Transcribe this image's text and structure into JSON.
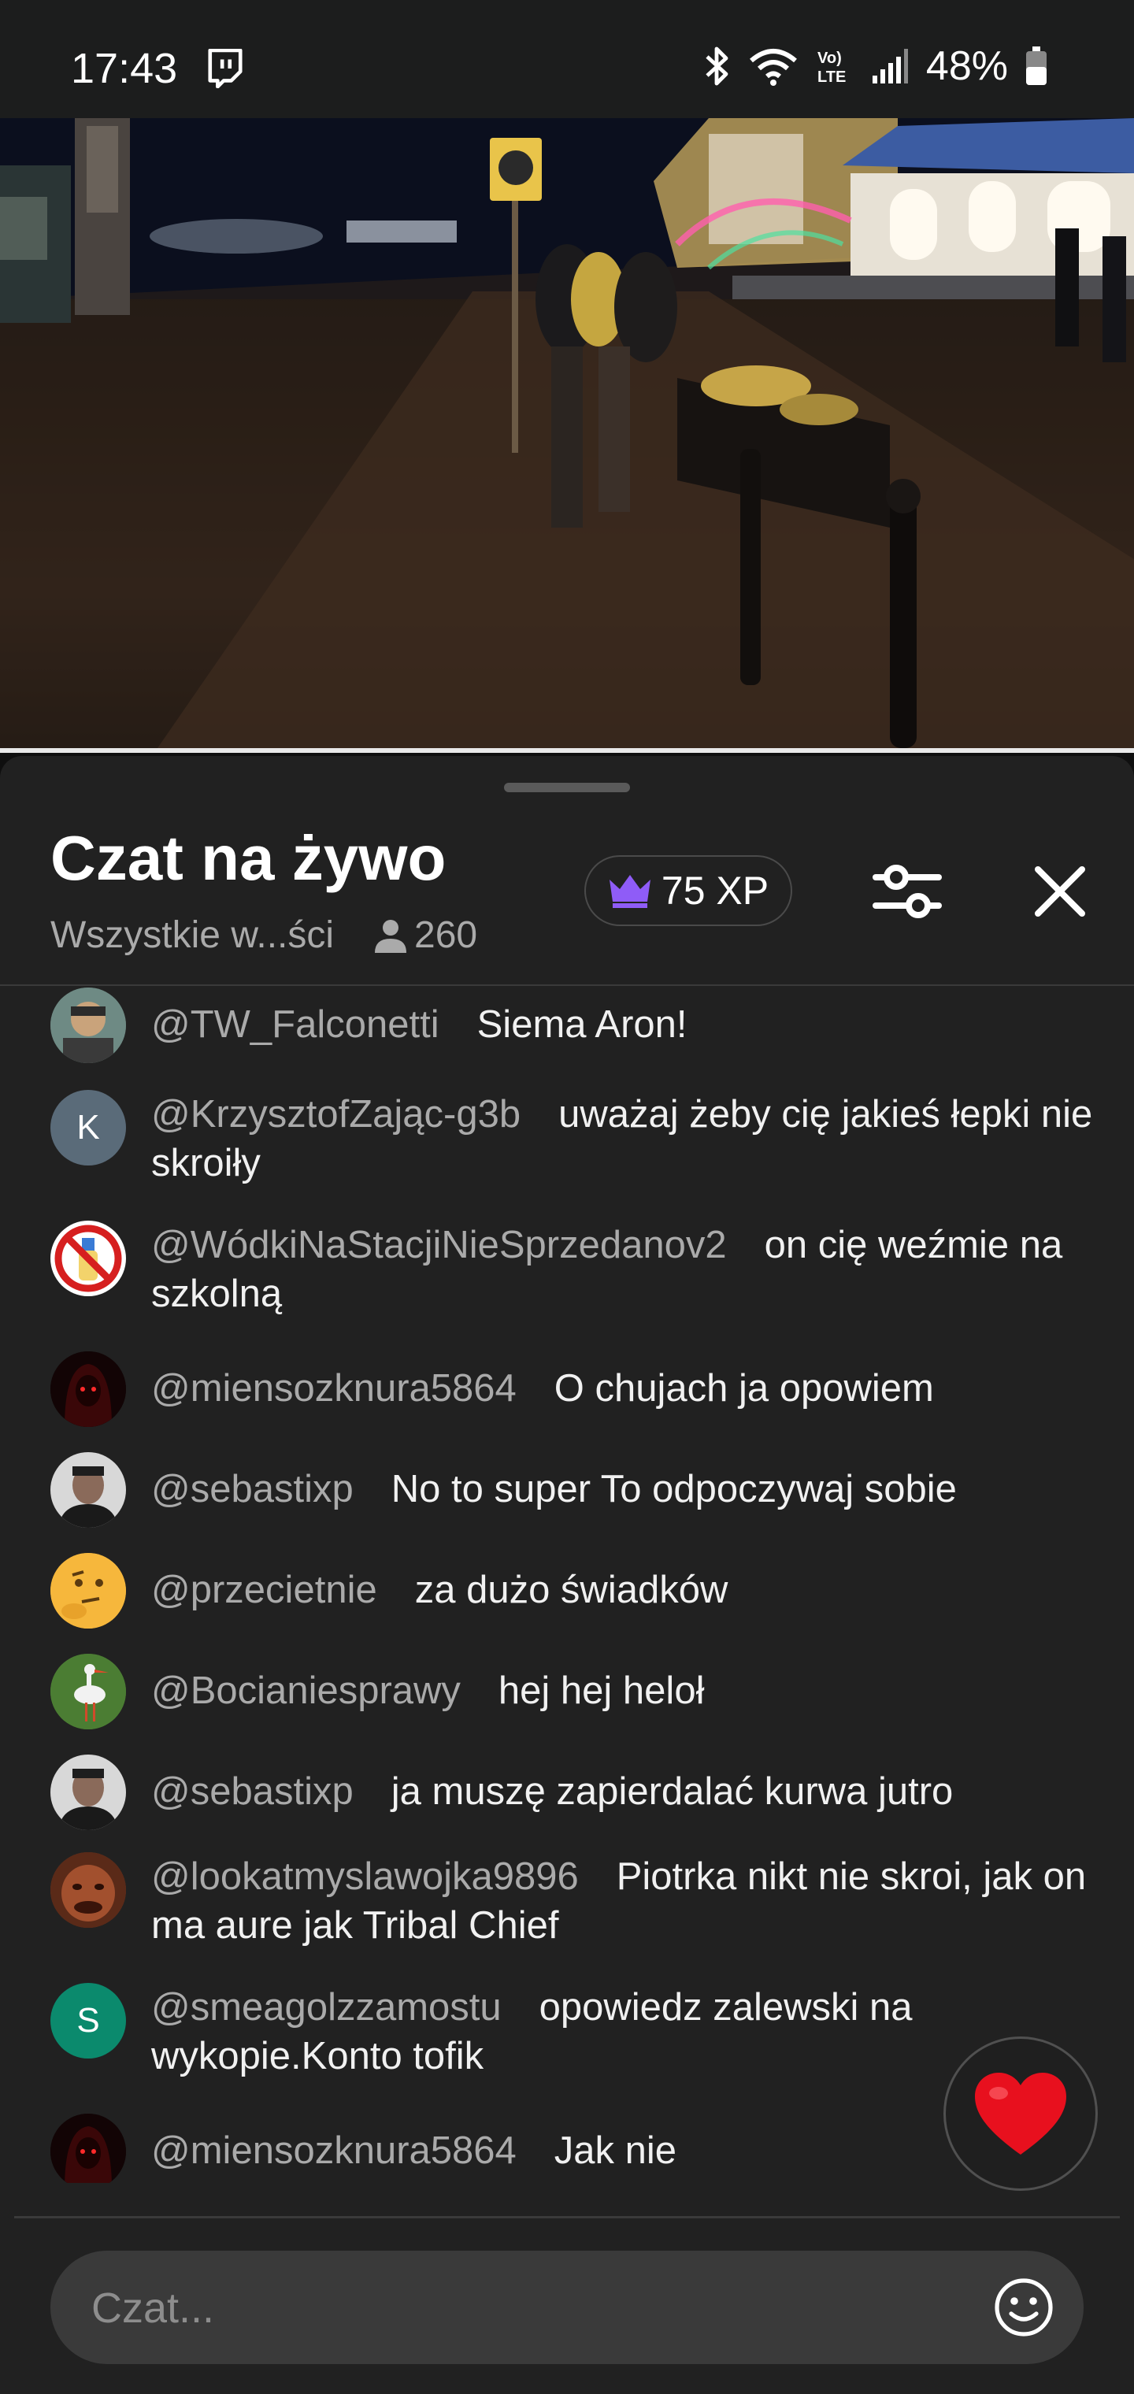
{
  "status_bar": {
    "time": "17:43",
    "battery": "48%",
    "icons": [
      "twitch-icon",
      "bluetooth-icon",
      "wifi-icon",
      "volte-icon",
      "signal-icon",
      "battery-icon"
    ]
  },
  "video": {
    "progress_fraction": 1.0
  },
  "chat": {
    "title": "Czat na żywo",
    "mode_label": "Wszystkie w...ści",
    "viewers": "260",
    "xp": "75 XP",
    "accent_color": "#8f5cf7"
  },
  "messages": [
    {
      "author": "@TW_Falconetti",
      "text": "Siema Aron!",
      "avatar": "photo"
    },
    {
      "author": "@KrzysztofZając-g3b",
      "text": "uważaj żeby cię jakieś łepki nie skroiły",
      "avatar_letter": "K",
      "avatar_color": "#5a6b79"
    },
    {
      "author": "@WódkiNaStacjiNieSprzedanov2",
      "text": "on cię weźmie na szkolną",
      "avatar": "no-alcohol-icon"
    },
    {
      "author": "@miensozknura5864",
      "text": "O chujach ja opowiem",
      "avatar": "photo"
    },
    {
      "author": "@sebastixp",
      "text": "No to super To odpoczywaj sobie",
      "avatar": "photo"
    },
    {
      "author": "@przecietnie",
      "text": "za dużo świadków",
      "avatar": "thinking-emoji"
    },
    {
      "author": "@Bocianiesprawy",
      "text": "hej hej heloł",
      "avatar": "photo"
    },
    {
      "author": "@sebastixp",
      "text": "ja muszę zapierdalać kurwa jutro",
      "avatar": "photo"
    },
    {
      "author": "@lookatmyslawojka9896",
      "text": "Piotrka nikt nie skroi, jak on ma aure jak Tribal Chief",
      "avatar": "photo"
    },
    {
      "author": "@smeagolzzamostu",
      "text": "opowiedz zalewski na wykopie.Konto tofik",
      "avatar_letter": "S",
      "avatar_color": "#0b8a6d"
    },
    {
      "author": "@miensozknura5864",
      "text": "Jak nie",
      "avatar": "photo"
    }
  ],
  "input": {
    "placeholder": "Czat..."
  }
}
